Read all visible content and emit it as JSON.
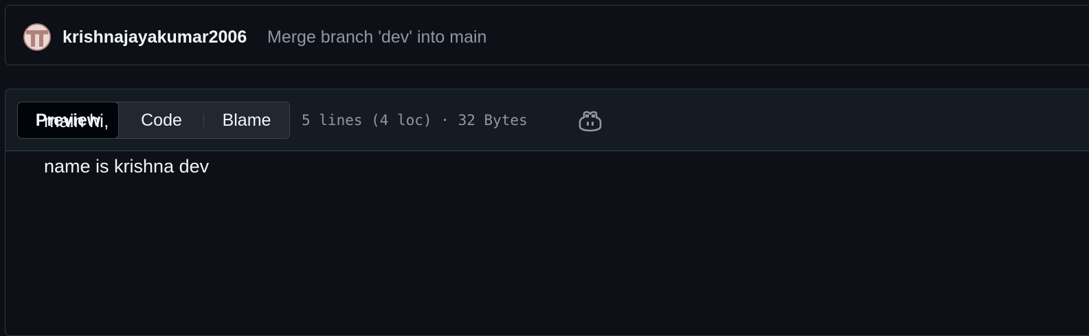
{
  "commit": {
    "author": "krishnajayakumar2006",
    "message": "Merge branch 'dev' into main"
  },
  "file_header": {
    "tabs": [
      {
        "label": "Preview",
        "selected": true
      },
      {
        "label": "Code",
        "selected": false
      },
      {
        "label": "Blame",
        "selected": false
      }
    ],
    "info": "5 lines (4 loc) · 32 Bytes",
    "copilot_icon": "copilot-icon"
  },
  "content": {
    "lines": [
      "main hi,",
      "name is krishna dev"
    ]
  },
  "colors": {
    "background": "#0d1117",
    "header_background": "#151b23",
    "border": "#30363d",
    "text_primary": "#f0f6fc",
    "text_muted": "#9198a1",
    "selected_tab": "#010409"
  }
}
